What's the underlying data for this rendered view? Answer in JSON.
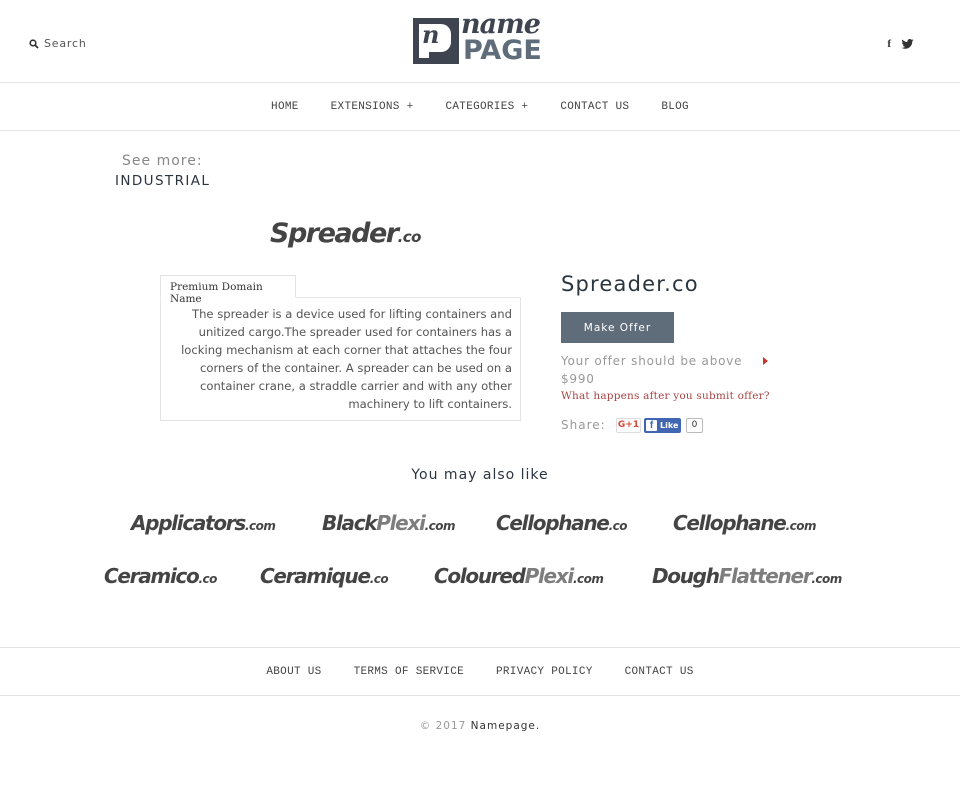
{
  "header": {
    "search_label": "Search",
    "logo": {
      "mark_letter": "n",
      "word_top": "name",
      "word_bottom": "PAGE"
    },
    "social": [
      {
        "name": "facebook",
        "glyph": "f"
      },
      {
        "name": "twitter",
        "glyph": "bird"
      }
    ]
  },
  "nav": {
    "items": [
      {
        "label": "HOME"
      },
      {
        "label": "EXTENSIONS +"
      },
      {
        "label": "CATEGORIES +"
      },
      {
        "label": "CONTACT US"
      },
      {
        "label": "BLOG"
      }
    ]
  },
  "see_more": {
    "label": "See more:",
    "category": "INDUSTRIAL"
  },
  "domain": {
    "logo_main": "Spreader",
    "logo_tld": ".co",
    "name": "Spreader.co",
    "tab_label": "Premium Domain Name",
    "description": "The spreader is a device used for lifting containers and unitized cargo.The spreader used for containers has a locking mechanism at each corner that attaches the four corners of the container. A spreader can be used on a container crane, a straddle carrier and with any other machinery to lift containers."
  },
  "offer": {
    "button_label": "Make Offer",
    "hint": "Your offer should be above",
    "min_price": "$990",
    "what_happens_link": "What happens after you submit offer?",
    "share_label": "Share:",
    "gplus_label": "G+1",
    "fb_like_label": "Like",
    "fb_like_count": "0"
  },
  "also_like": {
    "heading": "You may also like",
    "items": [
      {
        "a": "Applicators",
        "b": "",
        "tld": ".com"
      },
      {
        "a": "Black",
        "b": "Plexi",
        "tld": ".com"
      },
      {
        "a": "Cellophane",
        "b": "",
        "tld": ".co"
      },
      {
        "a": "Cellophane",
        "b": "",
        "tld": ".com"
      },
      {
        "a": "Ceramico",
        "b": "",
        "tld": ".co"
      },
      {
        "a": "Ceramique",
        "b": "",
        "tld": ".co"
      },
      {
        "a": "Coloured",
        "b": "Plexi",
        "tld": ".com"
      },
      {
        "a": "Dough",
        "b": "Flattener",
        "tld": ".com"
      }
    ]
  },
  "footer": {
    "links": [
      {
        "label": "ABOUT US"
      },
      {
        "label": "TERMS OF SERVICE"
      },
      {
        "label": "PRIVACY POLICY"
      },
      {
        "label": "CONTACT US"
      }
    ],
    "copyright": "© 2017",
    "brand": "Namepage."
  },
  "colors": {
    "brand_dark": "#3e4550",
    "brand_slate": "#5f6d7a",
    "link_red": "#a94442",
    "facebook_blue": "#4267b2"
  }
}
